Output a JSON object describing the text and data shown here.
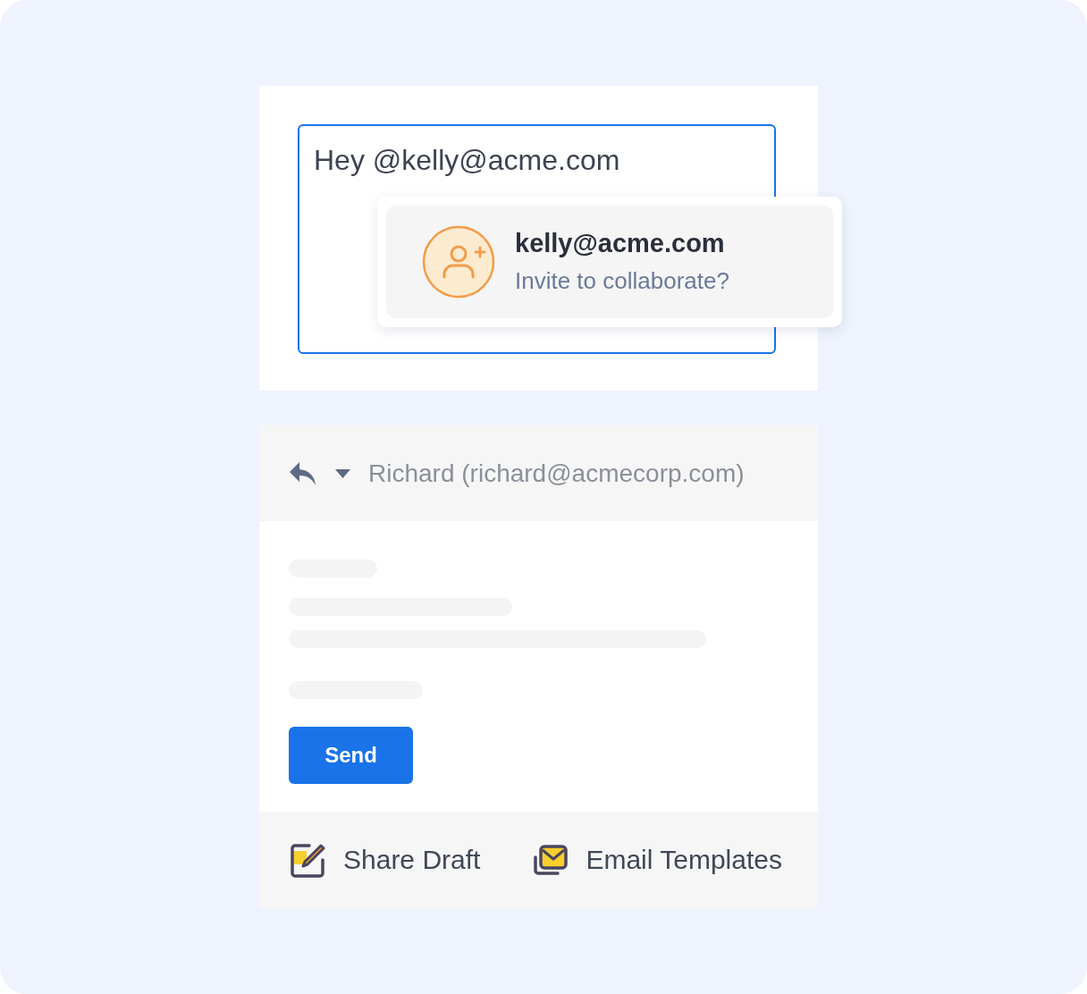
{
  "compose": {
    "value": "Hey @kelly@acme.com"
  },
  "mention_popup": {
    "email": "kelly@acme.com",
    "prompt": "Invite to collaborate?"
  },
  "reply": {
    "recipient": "Richard (richard@acmecorp.com)",
    "send_button": "Send"
  },
  "footer_actions": [
    {
      "kind": "draft",
      "label": "Share Draft"
    },
    {
      "kind": "templates",
      "label": "Email Templates"
    }
  ]
}
